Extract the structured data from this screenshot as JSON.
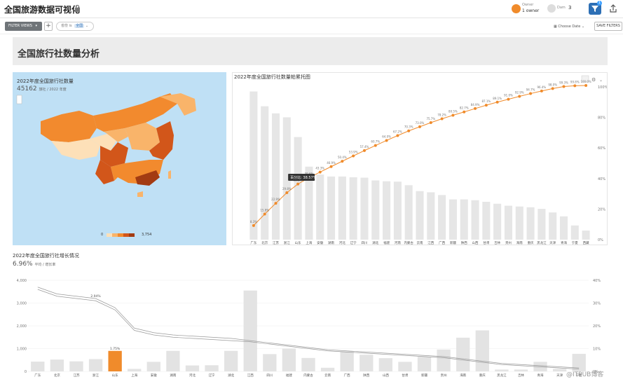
{
  "app": {
    "title": "全国旅游数据可视化"
  },
  "header_bar": {
    "owner_label": "Owner",
    "owner_value": "1 owner",
    "viewers_label": "Dam",
    "viewers_count": "3",
    "filter_badge": "1"
  },
  "toolbar": {
    "filter_views_label": "FILTER VIEWS",
    "add_label": "+",
    "filter_chip_prefix": "省份",
    "filter_chip_is": "is",
    "filter_chip_value": "全国",
    "choose_date_label": "Choose Date",
    "save_filters_label": "SAVE FILTERS"
  },
  "dashboard": {
    "title": "全国旅行社数量分析"
  },
  "map": {
    "title": "2022年度全国旅行社数量",
    "value": "45162",
    "unit": "旅社 / 2022 年度",
    "legend_min": "0",
    "legend_max": "3,754",
    "colors": [
      "#fde0b8",
      "#f9b46a",
      "#f28a2e",
      "#d2561a",
      "#a33b12"
    ]
  },
  "pareto": {
    "title": "2022年度全国旅行社数量帕累托图",
    "tooltip": "百分比: 38.57%",
    "chart_data": {
      "type": "bar",
      "categories": [
        "广东",
        "北京",
        "江苏",
        "浙江",
        "山东",
        "上海",
        "安徽",
        "湖南",
        "河北",
        "辽宁",
        "四川",
        "湖北",
        "福建",
        "河南",
        "内蒙古",
        "云南",
        "江西",
        "广西",
        "新疆",
        "陕西",
        "山西",
        "甘肃",
        "吉林",
        "贵州",
        "海南",
        "重庆",
        "黑龙江",
        "天津",
        "青海",
        "宁夏",
        "西藏",
        "宁夏"
      ],
      "values": [
        3754,
        3380,
        3200,
        3100,
        2600,
        1850,
        1650,
        1600,
        1600,
        1580,
        1570,
        1500,
        1480,
        1470,
        1380,
        1230,
        1200,
        1130,
        1020,
        1020,
        1000,
        960,
        910,
        860,
        840,
        820,
        780,
        690,
        590,
        360,
        230
      ],
      "cumulative_pct": [
        8.3,
        15.8,
        22.9,
        29.8,
        35.5,
        39.6,
        43.3,
        46.9,
        50.4,
        53.9,
        57.4,
        60.7,
        64.0,
        67.2,
        70.3,
        73.0,
        75.7,
        78.2,
        80.5,
        82.7,
        84.9,
        87.1,
        89.1,
        91.0,
        92.9,
        94.7,
        96.4,
        98.0,
        99.3,
        99.8,
        100
      ],
      "y2_ticks": [
        "0%",
        "20%",
        "40%",
        "60%",
        "80%",
        "100%"
      ],
      "y2lim": [
        0,
        100
      ],
      "bar_color": "#e6e6e6",
      "line_color": "#f08b2b"
    }
  },
  "growth": {
    "title": "2022年度全国旅行社增长情况",
    "value": "6.96%",
    "unit": "平均 / 增长率",
    "chart_data": {
      "type": "bar",
      "categories": [
        "广东",
        "北京",
        "江苏",
        "浙江",
        "山东",
        "上海",
        "安徽",
        "湖南",
        "河北",
        "辽宁",
        "湖北",
        "江西",
        "四川",
        "福建",
        "内蒙古",
        "云南",
        "广西",
        "陕西",
        "山西",
        "甘肃",
        "新疆",
        "贵州",
        "海南",
        "重庆",
        "黑龙江",
        "吉林",
        "青海",
        "天津",
        "宁夏"
      ],
      "values": [
        430,
        520,
        440,
        540,
        900,
        110,
        420,
        900,
        260,
        270,
        900,
        3550,
        760,
        1000,
        590,
        160,
        880,
        730,
        580,
        420,
        640,
        960,
        1480,
        1800,
        80,
        80,
        420,
        110,
        770
      ],
      "highlight_index": 4,
      "highlight_label": "1.75%",
      "line_label": "2.94%",
      "y_ticks": [
        "0",
        "1,000",
        "2,000",
        "3,000",
        "4,000"
      ],
      "ylim": [
        0,
        4000
      ],
      "y2_ticks": [
        "0%",
        "10%",
        "20%",
        "30%",
        "40%"
      ],
      "y2lim": [
        0,
        40
      ],
      "line1_pct": [
        36,
        33,
        32,
        31,
        27,
        18,
        16,
        15,
        14.5,
        14,
        13.5,
        13,
        12,
        11,
        10,
        9,
        8.5,
        8,
        7.5,
        7,
        6.5,
        6,
        5,
        4,
        3,
        2.5,
        2,
        1.5,
        1
      ],
      "line2_pct": [
        37,
        34,
        33,
        32,
        28,
        19,
        17,
        16,
        15.5,
        15,
        14.5,
        13.5,
        12.5,
        11.5,
        10.5,
        9.5,
        9,
        8.5,
        8,
        7.5,
        7,
        6.5,
        5.5,
        4.5,
        3.5,
        3,
        2.5,
        2,
        1.5
      ],
      "bar_color": "#e3e3e3",
      "highlight_color": "#f08b2b",
      "line_color": "#999999"
    }
  },
  "watermark": "@ITPUB博客"
}
